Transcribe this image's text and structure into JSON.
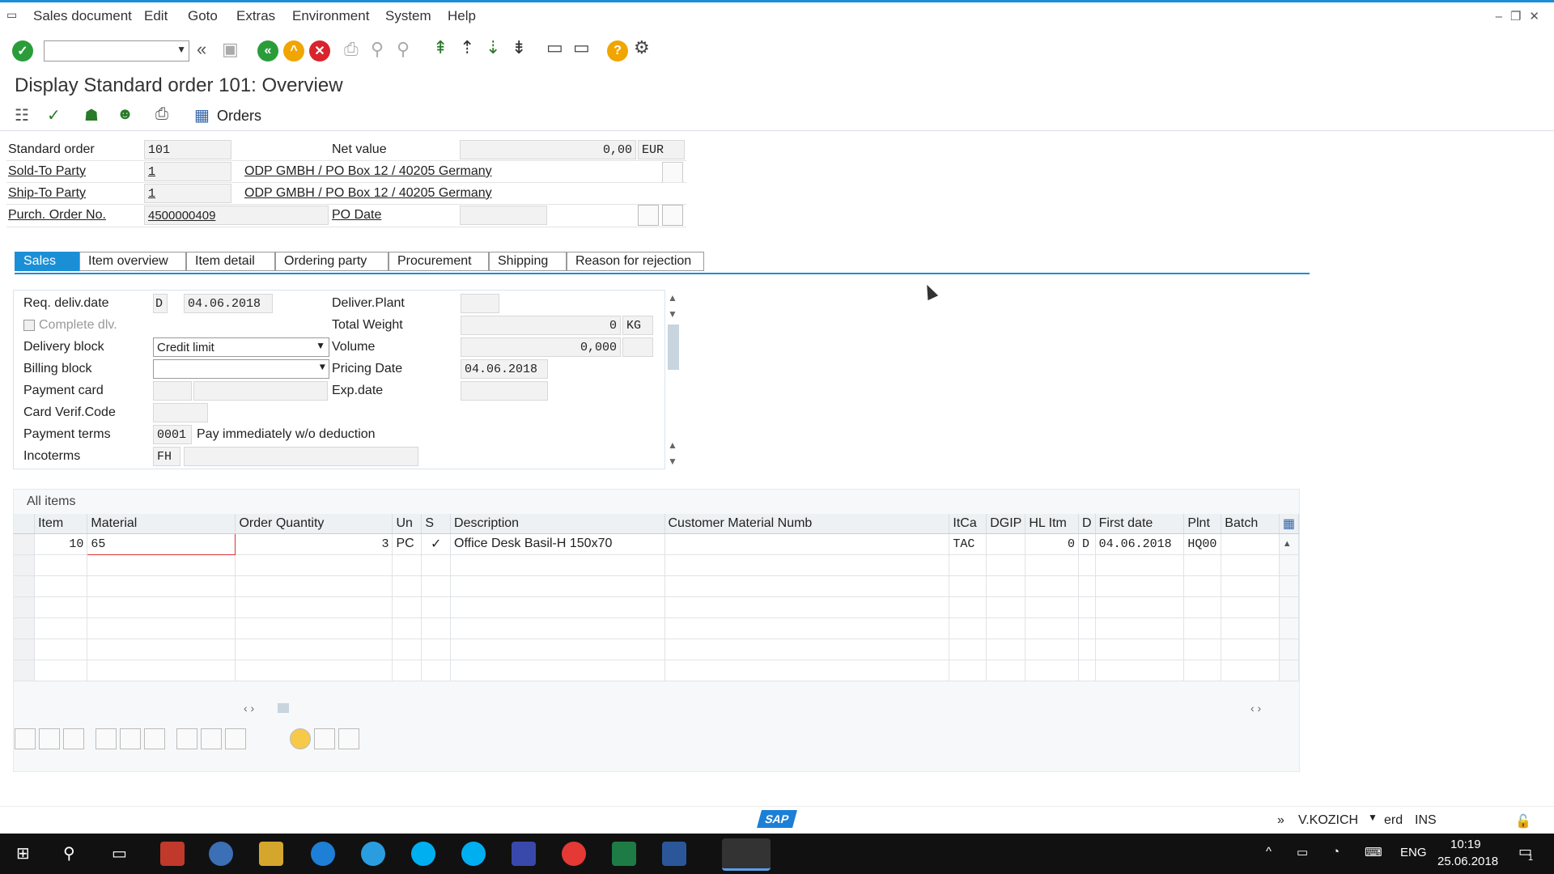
{
  "menu": [
    "Sales document",
    "Edit",
    "Goto",
    "Extras",
    "Environment",
    "System",
    "Help"
  ],
  "title": "Display Standard order 101: Overview",
  "app_toolbar": {
    "orders_label": "Orders"
  },
  "header": {
    "standard_order_label": "Standard order",
    "standard_order_value": "101",
    "net_value_label": "Net value",
    "net_value": "0,00",
    "currency": "EUR",
    "sold_to_label": "Sold-To Party",
    "sold_to_value": "1",
    "sold_to_address": "ODP GMBH / PO Box 12 / 40205 Germany",
    "ship_to_label": "Ship-To Party",
    "ship_to_value": "1",
    "ship_to_address": "ODP GMBH / PO Box 12 / 40205 Germany",
    "po_no_label": "Purch. Order No.",
    "po_no_value": "4500000409",
    "po_date_label": "PO Date",
    "po_date_value": ""
  },
  "tabs": [
    "Sales",
    "Item overview",
    "Item detail",
    "Ordering party",
    "Procurement",
    "Shipping",
    "Reason for rejection"
  ],
  "sales": {
    "req_deliv_label": "Req. deliv.date",
    "req_deliv_type": "D",
    "req_deliv_date": "04.06.2018",
    "deliver_plant_label": "Deliver.Plant",
    "complete_dlv_label": "Complete dlv.",
    "total_weight_label": "Total Weight",
    "total_weight": "0",
    "weight_unit": "KG",
    "delivery_block_label": "Delivery block",
    "delivery_block_value": "Credit limit",
    "volume_label": "Volume",
    "volume": "0,000",
    "billing_block_label": "Billing block",
    "billing_block_value": "",
    "pricing_date_label": "Pricing Date",
    "pricing_date": "04.06.2018",
    "payment_card_label": "Payment card",
    "exp_date_label": "Exp.date",
    "card_verif_label": "Card Verif.Code",
    "payment_terms_label": "Payment terms",
    "payment_terms_code": "0001",
    "payment_terms_text": "Pay immediately w/o deduction",
    "incoterms_label": "Incoterms",
    "incoterms_code": "FH",
    "incoterms_text": ""
  },
  "items": {
    "title": "All items",
    "columns": [
      "Item",
      "Material",
      "Order Quantity",
      "Un",
      "S",
      "Description",
      "Customer Material Numb",
      "ItCa",
      "DGIP",
      "HL Itm",
      "D",
      "First date",
      "Plnt",
      "Batch"
    ],
    "rows": [
      {
        "item": "10",
        "material": "65",
        "qty": "3",
        "un": "PC",
        "s": "✓",
        "description": "Office Desk Basil-H 150x70",
        "cust_mat": "",
        "itca": "TAC",
        "dgip": "",
        "hl_itm": "0",
        "d": "D",
        "first_date": "04.06.2018",
        "plnt": "HQ00",
        "batch": ""
      }
    ]
  },
  "status": {
    "user": "V.KOZICH",
    "system": "erd",
    "mode": "INS",
    "logo": "SAP"
  },
  "taskbar": {
    "lang": "ENG",
    "time": "10:19",
    "date": "25.06.2018",
    "notif": "1"
  }
}
